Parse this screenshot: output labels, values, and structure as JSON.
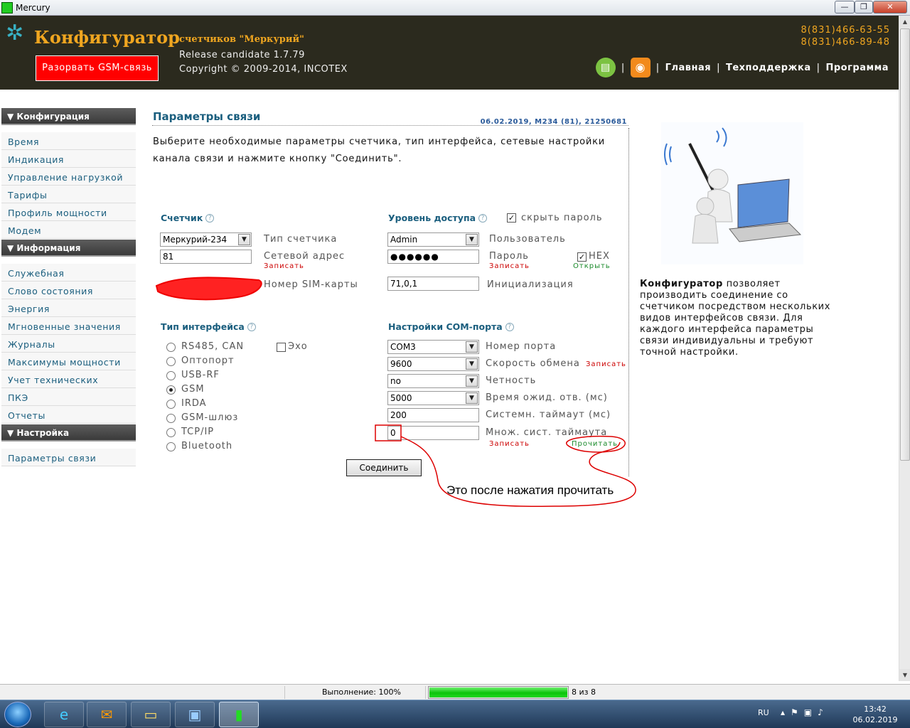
{
  "window": {
    "title": "Mercury",
    "btn_min": "—",
    "btn_max": "❐",
    "btn_close": "✕"
  },
  "header": {
    "logo": "Конфигуратор",
    "logo_sub": "счетчиков \"Меркурий\"",
    "release": "Release candidate 1.7.79",
    "copyright": "Copyright © 2009-2014, INCOTEX",
    "gsm_button": "Разорвать GSM-связь",
    "phone1": "8(831)466-63-55",
    "phone2": "8(831)466-89-48",
    "nav": {
      "sep": "|",
      "home": "Главная",
      "support": "Техподдержка",
      "program": "Программа"
    },
    "icons": {
      "print": "printer-icon",
      "rss": "rss-icon",
      "logo": "gear-icon"
    }
  },
  "sidebar": {
    "config_head": "▼ Конфигурация",
    "config_items": [
      "Время",
      "Индикация",
      "Управление нагрузкой",
      "Тарифы",
      "Профиль мощности",
      "Модем"
    ],
    "info_head": "▼ Информация",
    "info_items": [
      "Служебная",
      "Слово состояния",
      "Энергия",
      "Мгновенные значения",
      "Журналы",
      "Максимумы мощности",
      "Учет технических потерь",
      "ПКЭ",
      "Отчеты"
    ],
    "settings_head": "▼ Настройка",
    "settings_items": [
      "Параметры связи"
    ]
  },
  "main": {
    "title": "Параметры связи",
    "meta": "06.02.2019, M234 (81), 21250681",
    "intro": "Выберите необходимые параметры счетчика, тип интерфейса, сетевые настройки канала связи и нажмите кнопку \"Соединить\".",
    "help": "?",
    "meter": {
      "title": "Счетчик",
      "type_value": "Меркурий-234",
      "type_label": "Тип счетчика",
      "addr_value": "81",
      "addr_label": "Сетевой адрес",
      "write": "Записать",
      "sim_label": "Номер SIM-карты"
    },
    "access": {
      "title": "Уровень доступа",
      "hide_pw_label": "скрыть пароль",
      "user_value": "Admin",
      "user_label": "Пользователь",
      "pw_value": "●●●●●●",
      "pw_label": "Пароль",
      "hex_label": "HEX",
      "write": "Записать",
      "open": "Открыть",
      "init_value": "71,0,1",
      "init_label": "Инициализация"
    },
    "iface": {
      "title": "Тип интерфейса",
      "echo": "Эхо",
      "options": [
        "RS485, CAN",
        "Оптопорт",
        "USB-RF",
        "GSM",
        "IRDA",
        "GSM-шлюз",
        "TCP/IP",
        "Bluetooth"
      ],
      "selected": "GSM"
    },
    "com": {
      "title": "Настройки COM-порта",
      "port_value": "COM3",
      "port_label": "Номер порта",
      "speed_value": "9600",
      "speed_label": "Скорость обмена",
      "speed_write": "Записать",
      "parity_value": "no",
      "parity_label": "Четность",
      "wait_value": "5000",
      "wait_label": "Время ожид. отв. (мс)",
      "systimeout_value": "200",
      "systimeout_label": "Системн. таймаут (мс)",
      "mult_value": "0",
      "mult_label": "Множ. сист. таймаута",
      "write": "Записать",
      "read": "Прочитать"
    },
    "connect": "Соединить",
    "annotation": "Это после нажатия прочитать"
  },
  "aside": {
    "bold": "Конфигуратор",
    "text": " позволяет производить соединение со счетчиком посредством нескольких видов интерфейсов связи. Для каждого интерфейса параметры связи индивидуальны и требуют точной настройки."
  },
  "status": {
    "progress_label": "Выполнение: 100%",
    "progress": 1.0,
    "count": "8 из 8"
  },
  "taskbar": {
    "lang": "RU",
    "time": "13:42",
    "date": "06.02.2019"
  }
}
